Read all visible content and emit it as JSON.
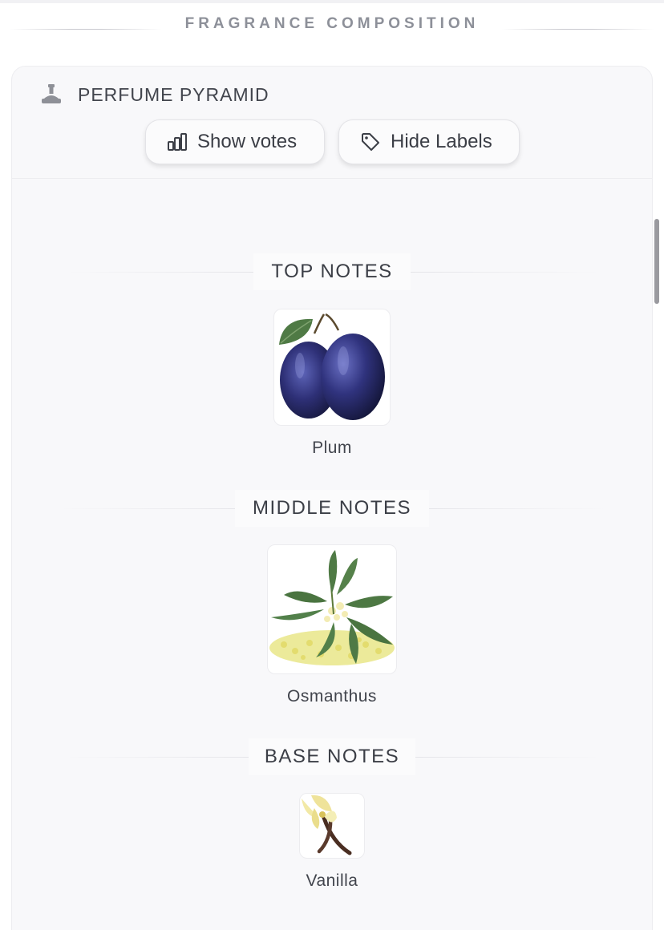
{
  "section": {
    "title": "FRAGRANCE COMPOSITION"
  },
  "pyramid": {
    "title": "PERFUME PYRAMID",
    "icon": "pyramid-icon",
    "buttons": {
      "votes": {
        "label": "Show votes",
        "icon": "bar-chart-icon"
      },
      "labels": {
        "label": "Hide Labels",
        "icon": "tag-icon"
      }
    }
  },
  "tiers": {
    "top": {
      "heading": "TOP NOTES",
      "notes": [
        {
          "name": "Plum",
          "icon": "plum-image"
        }
      ]
    },
    "middle": {
      "heading": "MIDDLE NOTES",
      "notes": [
        {
          "name": "Osmanthus",
          "icon": "osmanthus-image"
        }
      ]
    },
    "base": {
      "heading": "BASE NOTES",
      "notes": [
        {
          "name": "Vanilla",
          "icon": "vanilla-image"
        }
      ]
    }
  },
  "colors": {
    "background": "#ffffff",
    "card": "#f8f8fa",
    "text": "#3f424a",
    "muted_heading": "#8d9099",
    "plum": "#2e2f6e",
    "leaf": "#4f7a45",
    "vanilla_flower": "#f2e9a6"
  }
}
